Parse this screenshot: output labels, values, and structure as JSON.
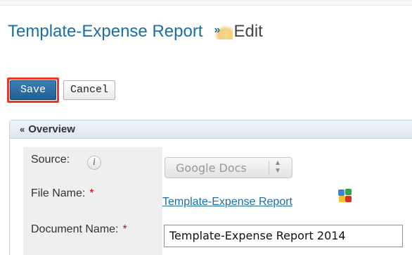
{
  "header": {
    "module_title": "Template-Expense Report",
    "separator": "»",
    "action_title": "Edit"
  },
  "buttons": {
    "save_label": "Save",
    "cancel_label": "Cancel"
  },
  "panel": {
    "title": "Overview",
    "fields": {
      "source": {
        "label": "Source:",
        "info_icon": "i",
        "value": "Google Docs"
      },
      "file_name": {
        "label": "File Name:",
        "required_mark": "*",
        "value": "Template-Expense Report"
      },
      "document_name": {
        "label": "Document Name:",
        "required_mark": "*",
        "value": "Template-Expense Report 2014"
      }
    }
  },
  "colors": {
    "link": "#1c6ea4",
    "save_highlight": "#e8392a",
    "primary_button": "#1f5f93",
    "label_background": "#efefef"
  },
  "icons": {
    "collapse": "collapse-arrows-icon",
    "info": "info-icon",
    "select_arrows": "select-arrows-icon",
    "google_docs": "google-docs-icon"
  }
}
